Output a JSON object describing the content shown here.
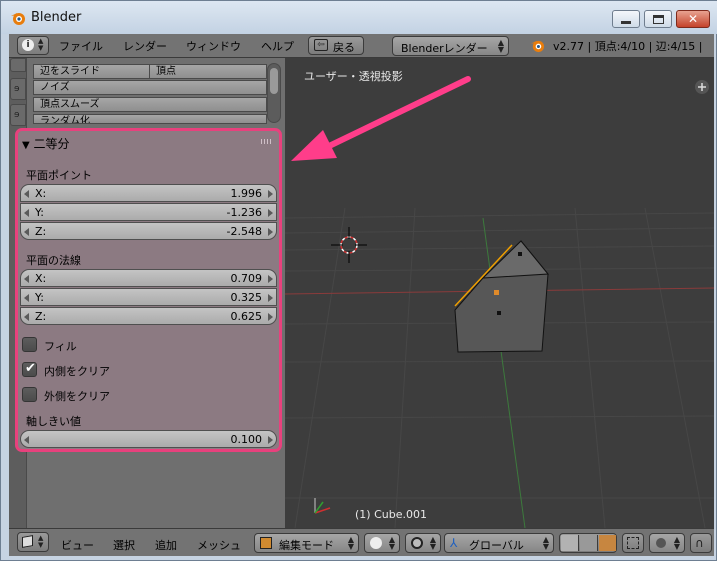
{
  "window": {
    "title": "Blender"
  },
  "top_menu": {
    "items": [
      "ファイル",
      "レンダー",
      "ウィンドウ",
      "ヘルプ"
    ],
    "back_label": "戻る",
    "render_engine": "Blenderレンダー",
    "stats": "v2.77 | 頂点:4/10 | 辺:4/15 |"
  },
  "tool_list": {
    "items": [
      "辺をスライド",
      "頂点",
      "ノイズ",
      "頂点スムーズ",
      "ランダム化"
    ]
  },
  "bisect_panel": {
    "title": "二等分",
    "plane_point_label": "平面ポイント",
    "plane_point": [
      {
        "axis": "X:",
        "value": "1.996"
      },
      {
        "axis": "Y:",
        "value": "-1.236"
      },
      {
        "axis": "Z:",
        "value": "-2.548"
      }
    ],
    "plane_normal_label": "平面の法線",
    "plane_normal": [
      {
        "axis": "X:",
        "value": "0.709"
      },
      {
        "axis": "Y:",
        "value": "0.325"
      },
      {
        "axis": "Z:",
        "value": "0.625"
      }
    ],
    "options": [
      {
        "label": "フィル",
        "checked": false
      },
      {
        "label": "内側をクリア",
        "checked": true
      },
      {
        "label": "外側をクリア",
        "checked": false
      }
    ],
    "threshold_label": "軸しきい値",
    "threshold_value": "0.100"
  },
  "viewport": {
    "view_name": "ユーザー・透視投影",
    "object_label": "(1) Cube.001"
  },
  "bottom_menu": {
    "items": [
      "ビュー",
      "選択",
      "追加",
      "メッシュ"
    ],
    "mode": "編集モード",
    "orientation": "グローバル"
  },
  "colors": {
    "highlight": "#e8417d",
    "arrow": "#ff3d8a",
    "viewport_bg": "#3d3d3d",
    "panel_bg": "#8c7a82"
  }
}
